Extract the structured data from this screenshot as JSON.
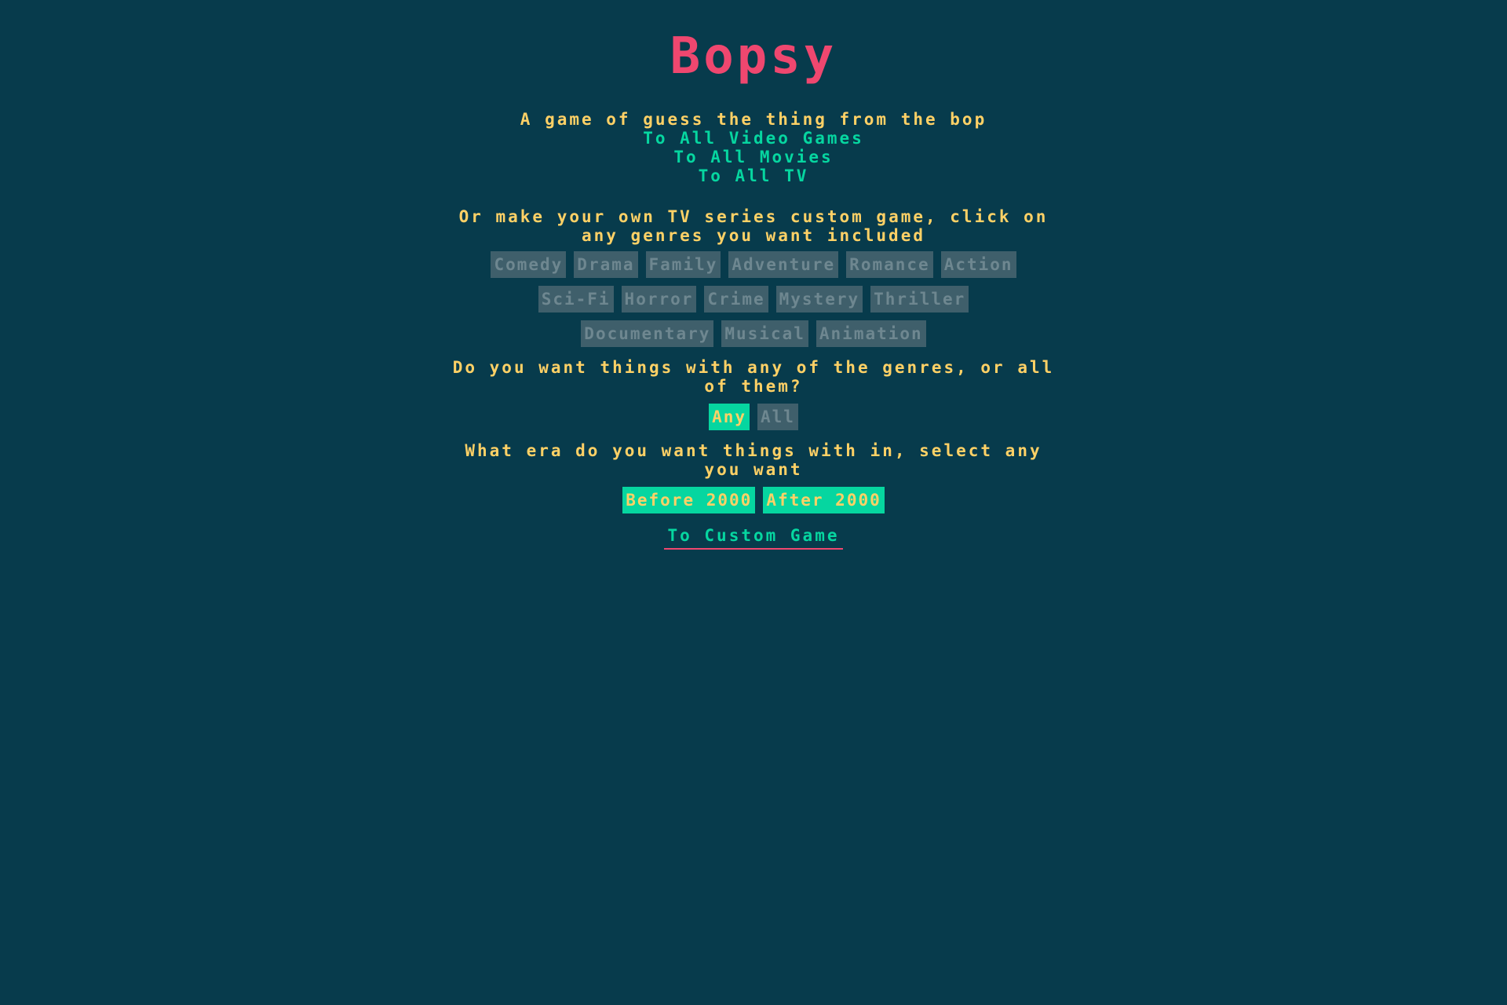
{
  "header": {
    "title": "Bopsy",
    "subtitle": "A game of guess the thing from the bop"
  },
  "nav": {
    "links": [
      {
        "label": "To All Video Games"
      },
      {
        "label": "To All Movies"
      },
      {
        "label": "To All TV"
      }
    ]
  },
  "custom": {
    "prompt": "Or make your own TV series custom game, click on any genres you want included",
    "genre_rows": [
      [
        {
          "label": "Comedy",
          "selected": false
        },
        {
          "label": "Drama",
          "selected": false
        },
        {
          "label": "Family",
          "selected": false
        },
        {
          "label": "Adventure",
          "selected": false
        },
        {
          "label": "Romance",
          "selected": false
        },
        {
          "label": "Action",
          "selected": false
        }
      ],
      [
        {
          "label": "Sci-Fi",
          "selected": false
        },
        {
          "label": "Horror",
          "selected": false
        },
        {
          "label": "Crime",
          "selected": false
        },
        {
          "label": "Mystery",
          "selected": false
        },
        {
          "label": "Thriller",
          "selected": false
        }
      ],
      [
        {
          "label": "Documentary",
          "selected": false
        },
        {
          "label": "Musical",
          "selected": false
        },
        {
          "label": "Animation",
          "selected": false
        }
      ]
    ],
    "match_prompt": "Do you want things with any of the genres, or all of them?",
    "match_options": [
      {
        "label": "Any",
        "selected": true
      },
      {
        "label": "All",
        "selected": false
      }
    ],
    "era_prompt": "What era do you want things with in, select any you want",
    "era_options": [
      {
        "label": "Before 2000",
        "selected": true
      },
      {
        "label": "After 2000",
        "selected": true
      }
    ],
    "submit_label": "To Custom Game"
  },
  "colors": {
    "background": "#073b4c",
    "title": "#ef476f",
    "text": "#ffd166",
    "link": "#06d6a0",
    "button_off": "#3f5f6b",
    "button_on": "#06d6a0"
  }
}
